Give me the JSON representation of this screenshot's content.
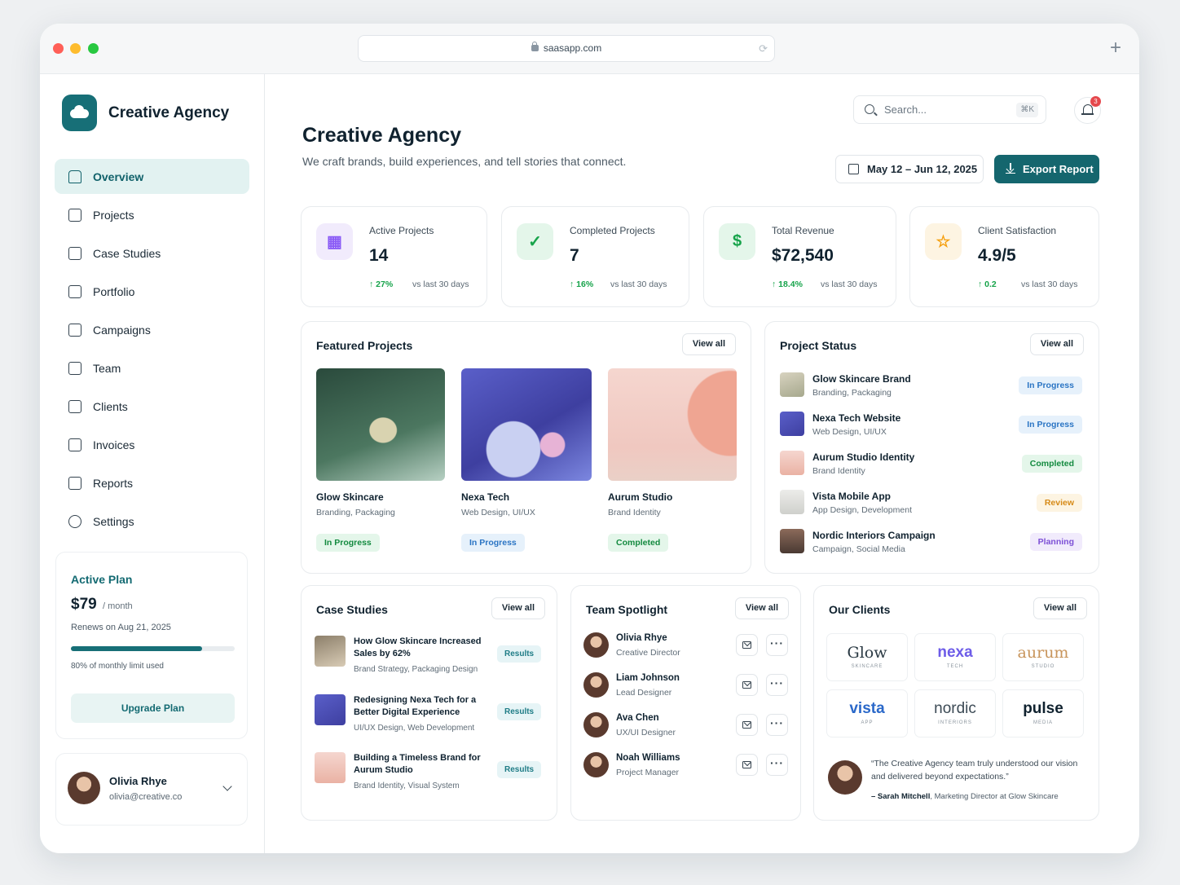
{
  "browser": {
    "url": "saasapp.com"
  },
  "sidebar": {
    "brand": "Creative Agency",
    "items": [
      {
        "label": "Overview",
        "icon": "home-icon"
      },
      {
        "label": "Projects",
        "icon": "projects-icon"
      },
      {
        "label": "Case Studies",
        "icon": "case-studies-icon"
      },
      {
        "label": "Portfolio",
        "icon": "portfolio-icon"
      },
      {
        "label": "Campaigns",
        "icon": "megaphone-icon"
      },
      {
        "label": "Team",
        "icon": "team-icon"
      },
      {
        "label": "Clients",
        "icon": "briefcase-icon"
      },
      {
        "label": "Invoices",
        "icon": "invoice-icon"
      },
      {
        "label": "Reports",
        "icon": "report-icon"
      },
      {
        "label": "Settings",
        "icon": "gear-icon"
      }
    ],
    "plan": {
      "title": "Active Plan",
      "price": "$79",
      "per": "/ month",
      "renews": "Renews on Aug 21, 2025",
      "used_fraction": 0.8,
      "used_label": "80% of monthly limit used",
      "upgrade": "Upgrade Plan"
    },
    "user": {
      "name": "Olivia Rhye",
      "email": "olivia@creative.co"
    }
  },
  "header": {
    "title": "Creative Agency",
    "subtitle": "We craft brands, build experiences, and tell stories that connect.",
    "search_placeholder": "Search...",
    "search_shortcut": "⌘K",
    "notifications": "3",
    "date_range": "May 12 – Jun 12, 2025",
    "export": "Export Report"
  },
  "stats": [
    {
      "label": "Active Projects",
      "value": "14",
      "delta": "↑ 27%",
      "vs": "vs last 30 days",
      "icon": "grid-icon",
      "color": "#8b5cf6"
    },
    {
      "label": "Completed Projects",
      "value": "7",
      "delta": "↑ 16%",
      "vs": "vs last 30 days",
      "icon": "check-circle-icon",
      "color": "#16a34a"
    },
    {
      "label": "Total Revenue",
      "value": "$72,540",
      "delta": "↑ 18.4%",
      "vs": "vs last 30 days",
      "icon": "dollar-icon",
      "color": "#16a34a"
    },
    {
      "label": "Client Satisfaction",
      "value": "4.9/5",
      "delta": "↑ 0.2",
      "vs": "vs last 30 days",
      "icon": "star-icon",
      "color": "#f59e0b"
    }
  ],
  "featured": {
    "title": "Featured Projects",
    "view_all": "View all",
    "projects": [
      {
        "name": "Glow Skincare",
        "category": "Branding, Packaging",
        "status": "In Progress"
      },
      {
        "name": "Nexa Tech",
        "category": "Web Design, UI/UX",
        "status": "In Progress"
      },
      {
        "name": "Aurum Studio",
        "category": "Brand Identity",
        "status": "Completed"
      }
    ]
  },
  "status": {
    "title": "Project Status",
    "view_all": "View all",
    "rows": [
      {
        "name": "Glow Skincare Brand",
        "sub": "Branding, Packaging",
        "status": "In Progress"
      },
      {
        "name": "Nexa Tech Website",
        "sub": "Web Design, UI/UX",
        "status": "In Progress"
      },
      {
        "name": "Aurum Studio Identity",
        "sub": "Brand Identity",
        "status": "Completed"
      },
      {
        "name": "Vista Mobile App",
        "sub": "App Design, Development",
        "status": "Review"
      },
      {
        "name": "Nordic Interiors Campaign",
        "sub": "Campaign, Social Media",
        "status": "Planning"
      }
    ]
  },
  "case_studies": {
    "title": "Case Studies",
    "view_all": "View all",
    "items": [
      {
        "title": "How Glow Skincare Increased Sales by 62%",
        "sub": "Brand Strategy, Packaging Design",
        "tag": "Results"
      },
      {
        "title": "Redesigning Nexa Tech for a Better Digital Experience",
        "sub": "UI/UX Design, Web Development",
        "tag": "Results"
      },
      {
        "title": "Building a Timeless Brand for Aurum Studio",
        "sub": "Brand Identity, Visual System",
        "tag": "Results"
      }
    ]
  },
  "team": {
    "title": "Team Spotlight",
    "view_all": "View all",
    "members": [
      {
        "name": "Olivia Rhye",
        "role": "Creative Director"
      },
      {
        "name": "Liam Johnson",
        "role": "Lead Designer"
      },
      {
        "name": "Ava Chen",
        "role": "UX/UI Designer"
      },
      {
        "name": "Noah Williams",
        "role": "Project Manager"
      }
    ]
  },
  "clients": {
    "title": "Our Clients",
    "view_all": "View all",
    "logos": [
      {
        "name": "Glow",
        "sub": "SKINCARE"
      },
      {
        "name": "nexa",
        "sub": "TECH"
      },
      {
        "name": "aurum",
        "sub": "STUDIO"
      },
      {
        "name": "vista",
        "sub": "APP"
      },
      {
        "name": "nordic",
        "sub": "INTERIORS"
      },
      {
        "name": "pulse",
        "sub": "MEDIA"
      }
    ],
    "quote": "“The Creative Agency team truly understood our vision and delivered beyond expectations.”",
    "author": "– Sarah Mitchell",
    "author_role": ", Marketing Director at Glow Skincare"
  }
}
